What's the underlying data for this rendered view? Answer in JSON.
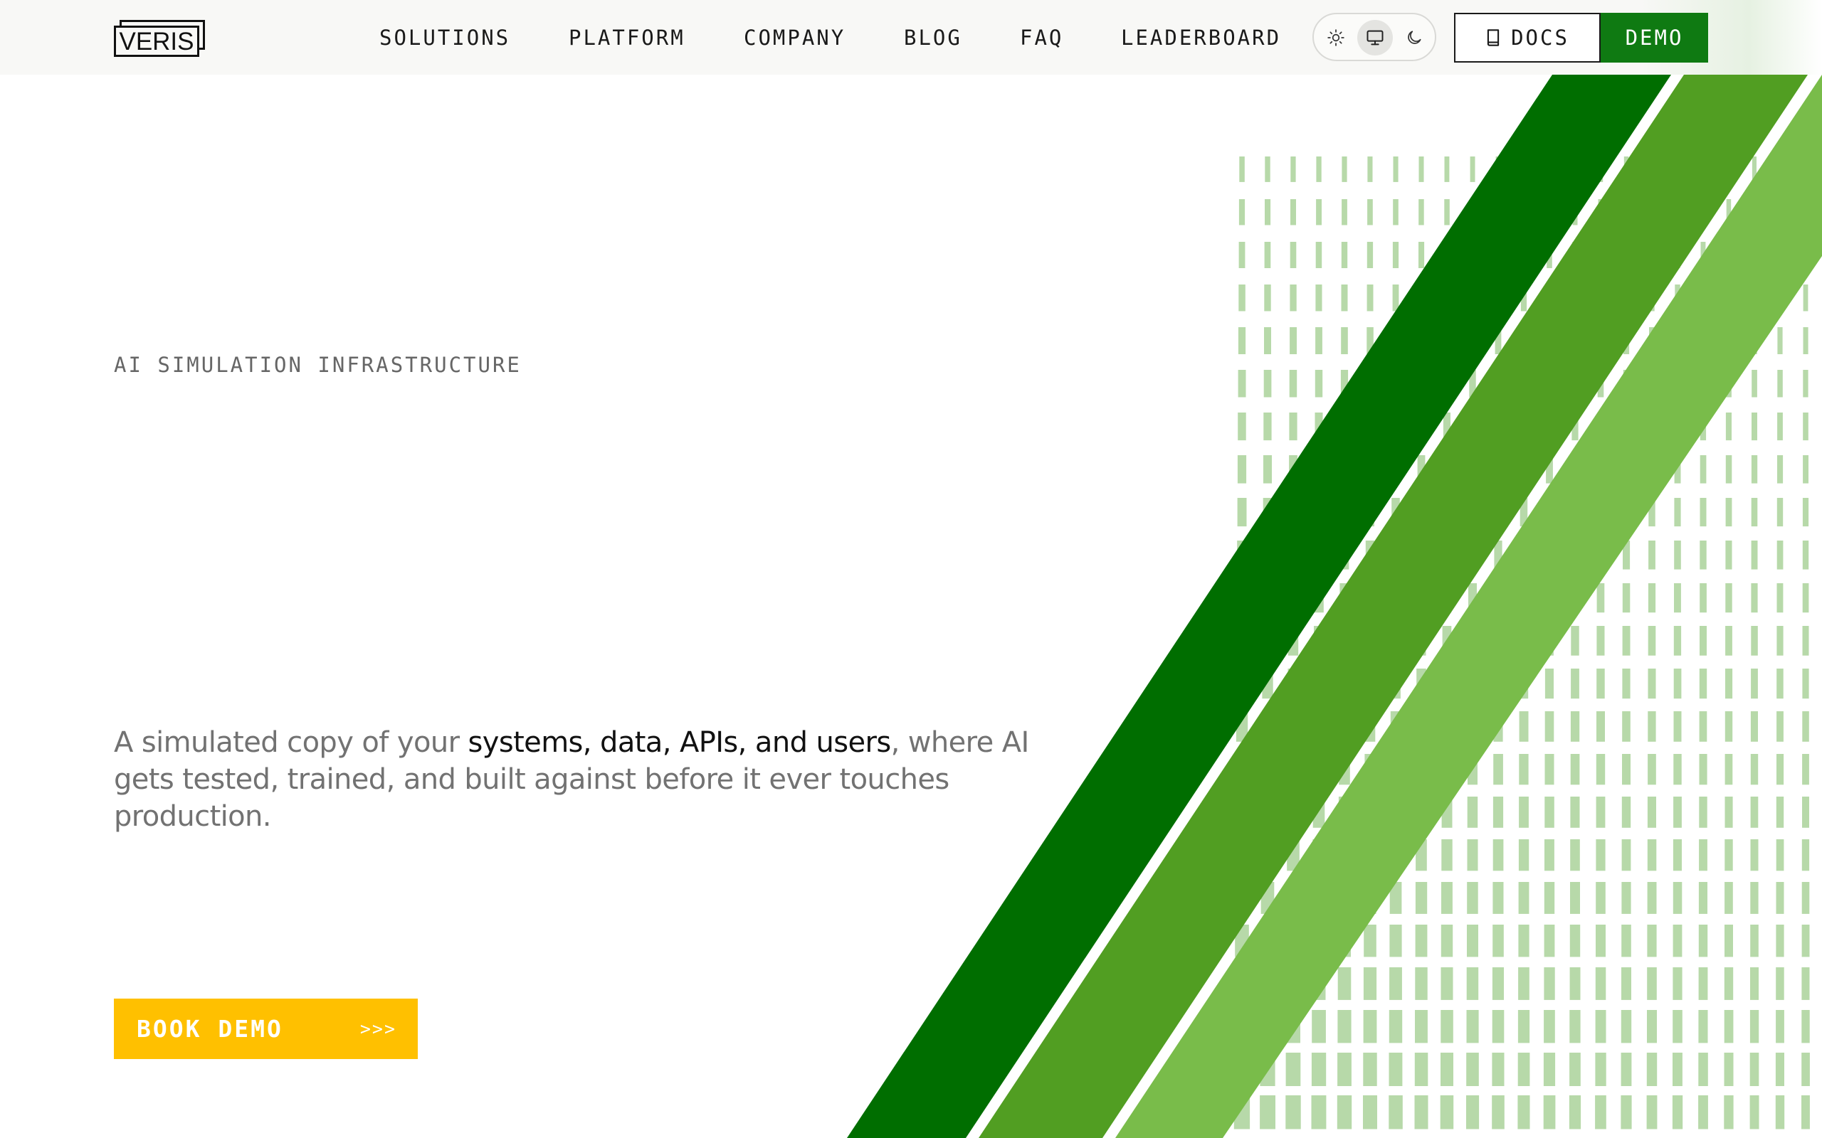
{
  "brand": {
    "logo_text": "VERIS"
  },
  "nav": {
    "links": [
      "SOLUTIONS",
      "PLATFORM",
      "COMPANY",
      "BLOG",
      "FAQ",
      "LEADERBOARD"
    ],
    "docs_label": "DOCS",
    "demo_label": "DEMO",
    "theme_modes": [
      "light",
      "system",
      "dark"
    ],
    "active_theme": "system"
  },
  "hero": {
    "eyebrow": "AI SIMULATION INFRASTRUCTURE",
    "desc_part1": "A simulated copy of your ",
    "desc_highlight": "systems, data, APIs, and users",
    "desc_part2": ", where AI gets tested, trained, and built against before it ever touches production.",
    "cta_label": "BOOK DEMO",
    "cta_arrows": ">>>"
  },
  "colors": {
    "accent_green": "#0f7a12",
    "stripe_dark": "#006e00",
    "stripe_mid": "#519e22",
    "stripe_light": "#79bc4a",
    "grid_green": "#b7d9a9",
    "cta_yellow": "#ffc000"
  },
  "icons": {
    "light": "sun-icon",
    "system": "monitor-icon",
    "dark": "moon-icon",
    "docs": "book-icon"
  }
}
